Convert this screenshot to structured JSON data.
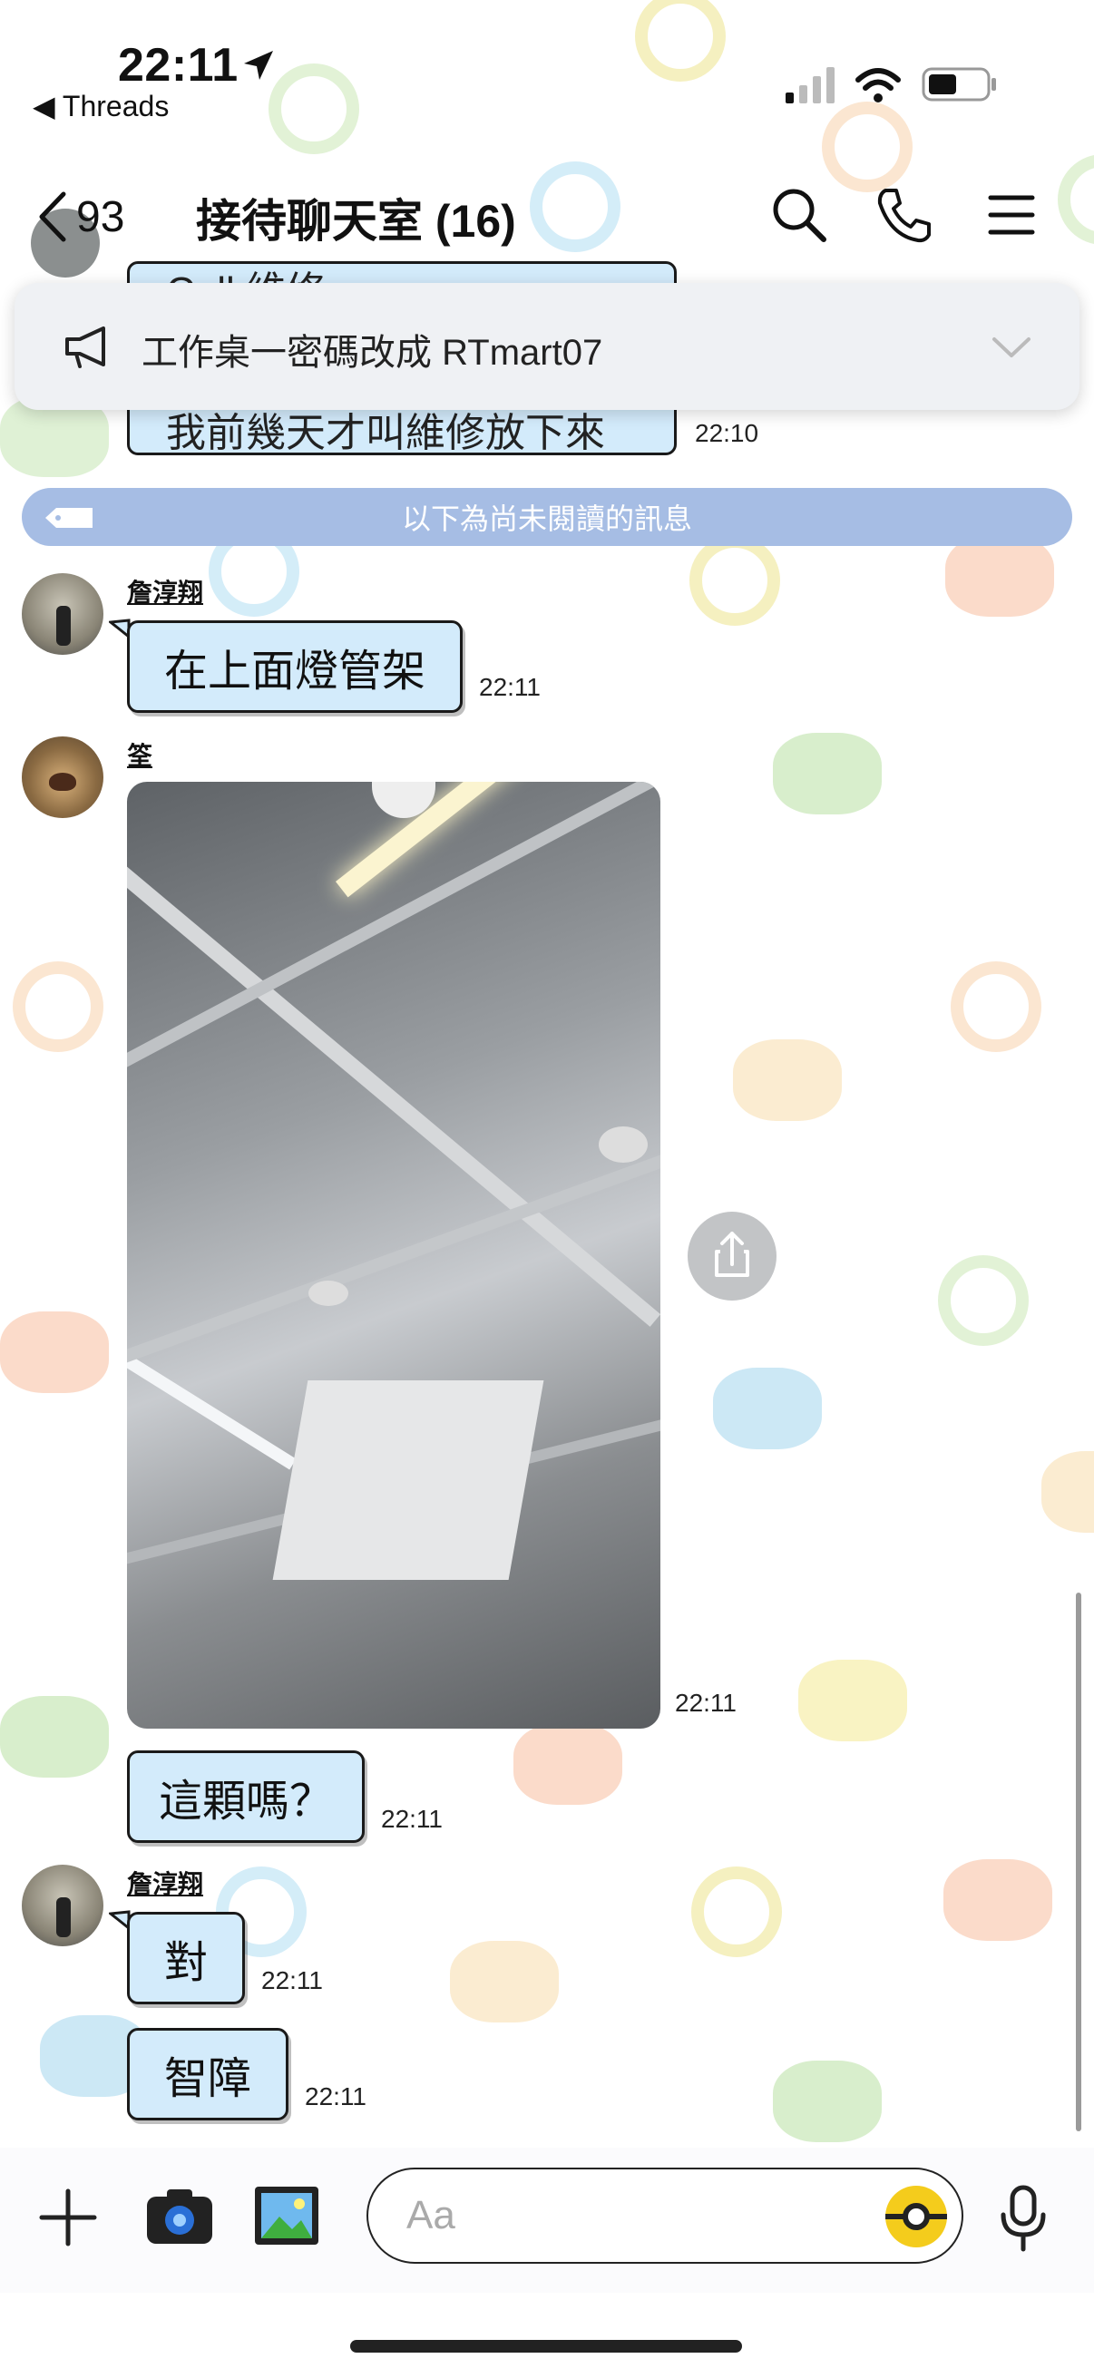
{
  "status": {
    "time": "22:11",
    "back_app": "◀ Threads"
  },
  "nav": {
    "back_count": "93",
    "title": "接待聊天室 (16)"
  },
  "announcement": {
    "text": "工作桌一密碼改成 RTmart07"
  },
  "hidden_messages": [
    {
      "text": "Call 維修",
      "time": ""
    },
    {
      "text": "我前幾天才叫維修放下來",
      "time": "22:10"
    }
  ],
  "unread_divider": "以下為尚未閱讀的訊息",
  "messages": [
    {
      "sender": "詹淳翔",
      "text": "在上面燈管架",
      "time": "22:11"
    },
    {
      "sender": "筌",
      "image": "ceiling-photo",
      "time": "22:11"
    },
    {
      "sender": "",
      "text": "這顆嗎？",
      "time": "22:11"
    },
    {
      "sender": "詹淳翔",
      "text": "對",
      "time": "22:11"
    },
    {
      "sender": "",
      "text": "智障",
      "time": "22:11"
    }
  ],
  "input": {
    "placeholder": "Aa"
  },
  "colors": {
    "bubble": "#d3ebfb",
    "unread_bar": "#a6bde4",
    "announcement_bg": "#eff1f4"
  }
}
